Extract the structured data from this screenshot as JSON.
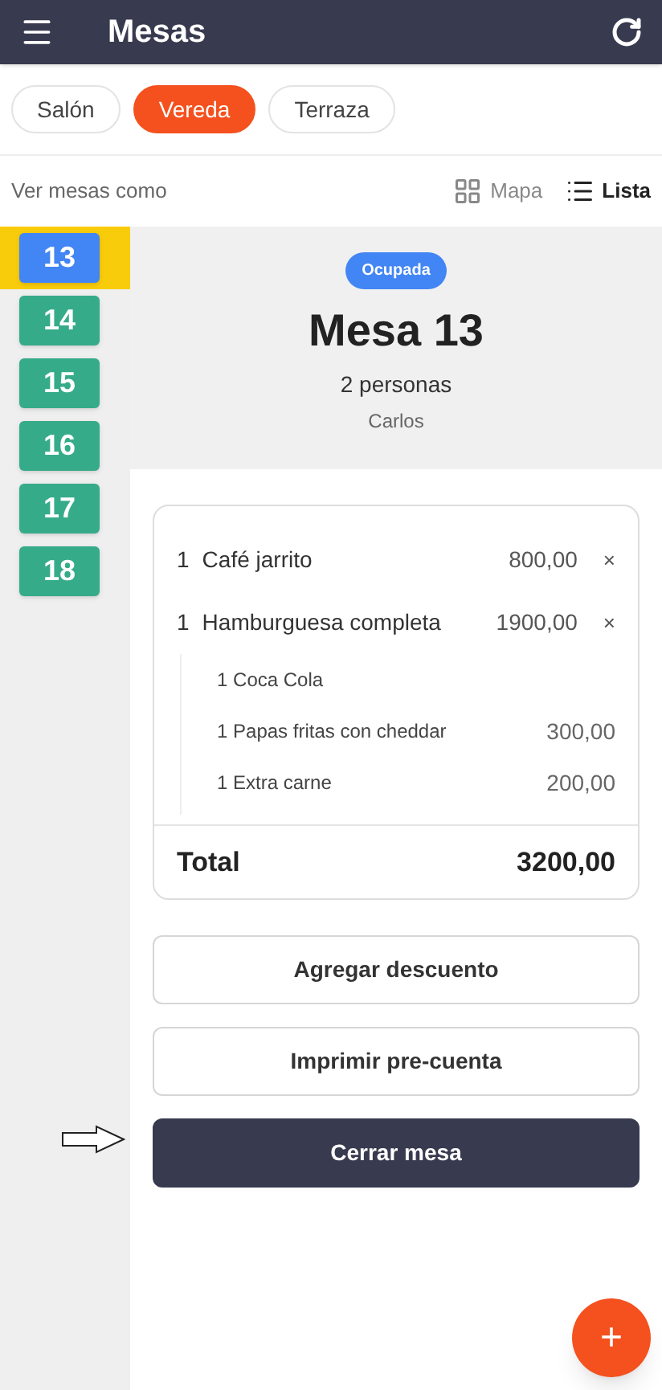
{
  "app_bar": {
    "title": "Mesas"
  },
  "zones": [
    {
      "label": "Salón",
      "selected": false
    },
    {
      "label": "Vereda",
      "selected": true
    },
    {
      "label": "Terraza",
      "selected": false
    }
  ],
  "view": {
    "label": "Ver mesas como",
    "options": [
      {
        "label": "Mapa",
        "kind": "grid",
        "selected": false
      },
      {
        "label": "Lista",
        "kind": "list",
        "selected": true
      }
    ]
  },
  "tables": [
    {
      "number": "13",
      "color": "#4285f4",
      "selected": true
    },
    {
      "number": "14",
      "color": "#36ab8a",
      "selected": false
    },
    {
      "number": "15",
      "color": "#36ab8a",
      "selected": false
    },
    {
      "number": "16",
      "color": "#36ab8a",
      "selected": false
    },
    {
      "number": "17",
      "color": "#36ab8a",
      "selected": false
    },
    {
      "number": "18",
      "color": "#36ab8a",
      "selected": false
    }
  ],
  "detail": {
    "status": "Ocupada",
    "title": "Mesa 13",
    "guests": "2 personas",
    "waiter": "Carlos"
  },
  "order": {
    "items": [
      {
        "qty": "1",
        "name": "Café jarrito",
        "price": "800,00",
        "remove": "×"
      },
      {
        "qty": "1",
        "name": "Hamburguesa completa",
        "price": "1900,00",
        "remove": "×",
        "children": [
          {
            "qty": "1",
            "name": "Coca Cola"
          },
          {
            "qty": "1",
            "name": "Papas fritas con cheddar",
            "price": "300,00"
          },
          {
            "qty": "1",
            "name": "Extra carne",
            "price": "200,00"
          }
        ]
      }
    ],
    "total_label": "Total",
    "total": "3200,00"
  },
  "actions": [
    {
      "label": "Agregar descuento",
      "kind": "outline"
    },
    {
      "label": "Imprimir pre-cuenta",
      "kind": "outline"
    },
    {
      "label": "Cerrar mesa",
      "kind": "primary"
    }
  ],
  "fab": {
    "label": "+"
  }
}
